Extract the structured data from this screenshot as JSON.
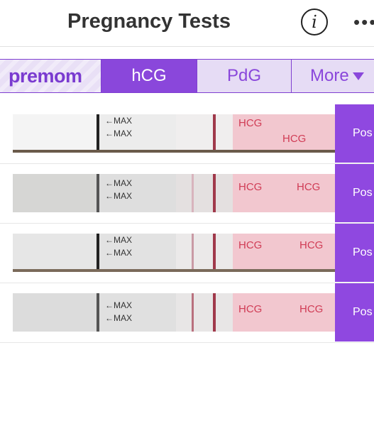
{
  "header": {
    "title": "Pregnancy Tests",
    "info_glyph": "i",
    "more_glyph": "•••"
  },
  "tabs": {
    "brand": "premom",
    "items": [
      {
        "label": "hCG",
        "selected": true
      },
      {
        "label": "PdG",
        "selected": false
      },
      {
        "label": "More",
        "selected": false
      }
    ]
  },
  "colors": {
    "accent": "#8a47db",
    "accent_light": "#e6dcf5",
    "test_line": "#a0394b",
    "handle_pink": "#f2c7cf"
  },
  "tests": [
    {
      "max_label": "←MAX",
      "brand_text": "HCG",
      "result": "Pos"
    },
    {
      "max_label": "←MAX",
      "brand_text": "HCG",
      "result": "Pos"
    },
    {
      "max_label": "←MAX",
      "brand_text": "HCG",
      "result": "Pos"
    },
    {
      "max_label": "←MAX",
      "brand_text": "HCG",
      "result": "Pos"
    }
  ]
}
